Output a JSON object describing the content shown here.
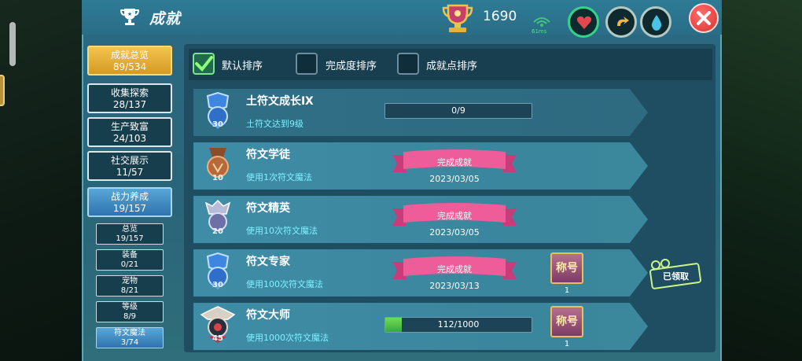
{
  "header": {
    "title": "成就",
    "points": "1690",
    "ping": "61ms"
  },
  "sidebar": {
    "items": [
      {
        "label": "成就总览",
        "count": "89/534"
      },
      {
        "label": "收集探索",
        "count": "28/137"
      },
      {
        "label": "生产致富",
        "count": "24/103"
      },
      {
        "label": "社交展示",
        "count": "11/57"
      },
      {
        "label": "战力养成",
        "count": "19/157"
      }
    ],
    "sub_items": [
      {
        "label": "总览",
        "count": "19/157"
      },
      {
        "label": "装备",
        "count": "0/21"
      },
      {
        "label": "宠物",
        "count": "8/21"
      },
      {
        "label": "等级",
        "count": "8/9"
      },
      {
        "label": "符文魔法",
        "count": "3/74"
      }
    ]
  },
  "sort": {
    "default": "默认排序",
    "completion": "完成度排序",
    "points": "成就点排序"
  },
  "achievements": [
    {
      "title": "土符文成长Ⅸ",
      "desc": "土符文达到9级",
      "points": "30",
      "progress": "0/9",
      "progress_fraction": 0
    },
    {
      "title": "符文学徒",
      "desc": "使用1次符文魔法",
      "points": "10",
      "status": "完成成就",
      "date": "2023/03/05"
    },
    {
      "title": "符文精英",
      "desc": "使用10次符文魔法",
      "points": "20",
      "status": "完成成就",
      "date": "2023/03/05"
    },
    {
      "title": "符文专家",
      "desc": "使用100次符文魔法",
      "points": "30",
      "status": "完成成就",
      "date": "2023/03/13",
      "reward_label": "称号",
      "reward_count": "1"
    },
    {
      "title": "符文大师",
      "desc": "使用1000次符文魔法",
      "points": "45",
      "progress": "112/1000",
      "progress_fraction": 0.112,
      "reward_label": "称号",
      "reward_count": "1"
    }
  ],
  "claim": {
    "label": "已领取"
  },
  "colors": {
    "accent_gold": "#f2c44e",
    "accent_blue": "#2f73ae",
    "ribbon_pink": "#e94e8f",
    "progress_green": "#3aa83d"
  }
}
